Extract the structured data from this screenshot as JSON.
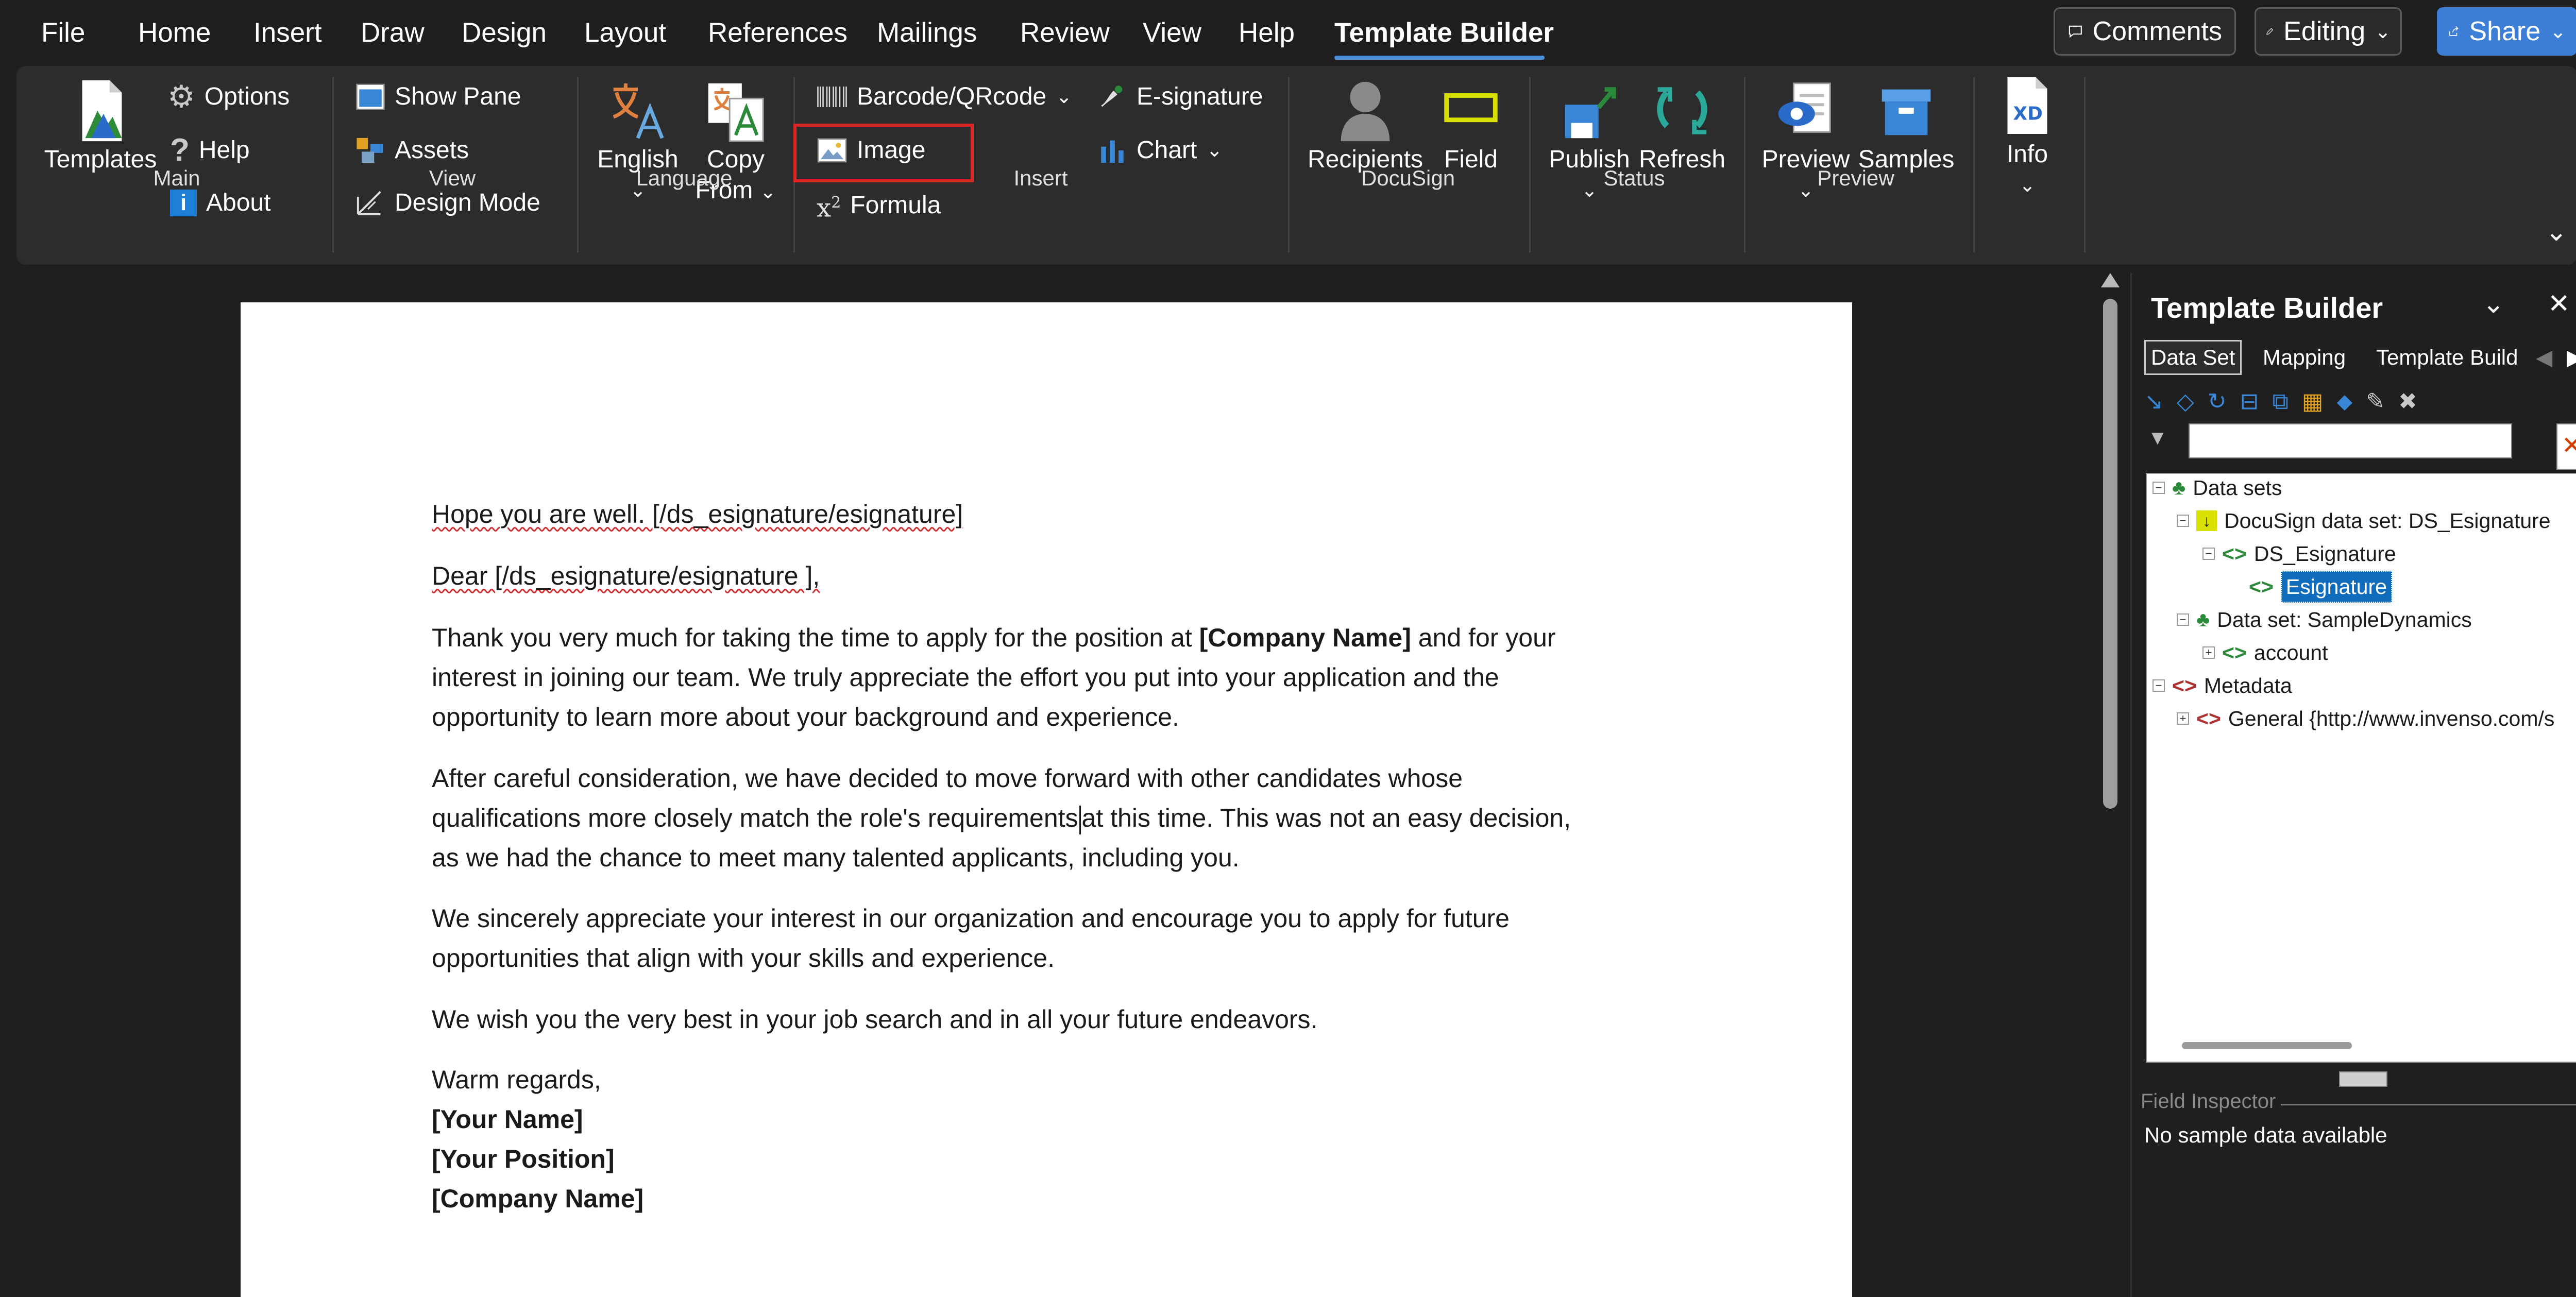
{
  "menu": {
    "items": [
      "File",
      "Home",
      "Insert",
      "Draw",
      "Design",
      "Layout",
      "References",
      "Mailings",
      "Review",
      "View",
      "Help",
      "Template Builder"
    ],
    "comments": "Comments",
    "editing": "Editing",
    "share": "Share"
  },
  "ribbon": {
    "main": {
      "templates": "Templates",
      "options": "Options",
      "help": "Help",
      "about": "About",
      "label": "Main"
    },
    "view": {
      "show_pane": "Show Pane",
      "assets": "Assets",
      "design_mode": "Design Mode",
      "label": "View"
    },
    "language": {
      "english": "English",
      "copy_from_1": "Copy",
      "copy_from_2": "From",
      "label": "Language"
    },
    "insert": {
      "barcode": "Barcode/QRcode",
      "image": "Image",
      "formula": "Formula",
      "esignature": "E-signature",
      "chart": "Chart",
      "label": "Insert"
    },
    "docusign": {
      "recipients": "Recipients",
      "field": "Field",
      "label": "DocuSign"
    },
    "status": {
      "publish": "Publish",
      "refresh": "Refresh",
      "label": "Status"
    },
    "preview": {
      "preview": "Preview",
      "samples": "Samples",
      "label": "Preview"
    },
    "info": {
      "info": "Info"
    },
    "accent_highlight": "#e02424"
  },
  "document": {
    "p1": "Hope you are well. [/ds_esignature/esignature]",
    "p2": "Dear [/ds_esignature/esignature ],",
    "p3a": "Thank you very much for taking the time to apply for the position at ",
    "p3b": "[Company Name]",
    "p3c": " and for your",
    "p3d": "interest in joining our team. We truly appreciate the effort you put into your application and the",
    "p3e": "opportunity to learn more about your background and experience.",
    "p4a": "After careful consideration, we have decided to move forward with other candidates whose",
    "p4b": "qualifications more closely match the role's requirements",
    "p4c": "at this time. This was not an easy decision,",
    "p4d": "as we had the chance to meet many talented applicants, including you.",
    "p5a": "We sincerely appreciate your interest in our organization and encourage you to apply for future",
    "p5b": "opportunities that align with your skills and experience.",
    "p6": "We wish you the very best in your job search and in all your future endeavors.",
    "p7": "Warm regards,",
    "p8": "[Your Name]",
    "p9": "[Your Position]",
    "p10": "[Company Name]"
  },
  "panel": {
    "title": "Template Builder",
    "tabs": [
      "Data Set",
      "Mapping",
      "Template Build"
    ],
    "tree": {
      "n1": "Data sets",
      "n2": "DocuSign data set: DS_Esignature",
      "n3": "DS_Esignature",
      "n4": "Esignature",
      "n5": "Data set: SampleDynamics",
      "n6": "account",
      "n7": "Metadata",
      "n8": "General {http://www.invenso.com/s"
    },
    "field_inspector": "Field Inspector",
    "no_sample": "No sample data available"
  }
}
